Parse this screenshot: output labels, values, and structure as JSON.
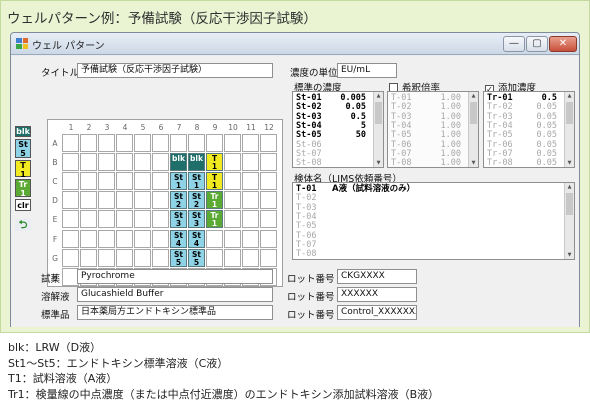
{
  "heading": "ウェルパターン例：予備試験（反応干渉因子試験）",
  "window": {
    "title": "ウェル パターン",
    "min": "—",
    "max": "▢",
    "close": "✕"
  },
  "form": {
    "title_label": "タイトル",
    "title_value": "予備試験（反応干渉因子試験）",
    "unit_label": "濃度の単位",
    "unit_value": "EU/mL",
    "reagent_label": "試薬",
    "reagent_value": "Pyrochrome",
    "solvent_label": "溶解液",
    "solvent_value": "Glucashield Buffer",
    "standard_label": "標準品",
    "standard_value": "日本薬局方エンドトキシン標準品",
    "lot_label": "ロット番号",
    "lot1": "CKGXXXX",
    "lot2": "XXXXXX",
    "lot3": "Control_XXXXXXX"
  },
  "palette": [
    {
      "label": "blk",
      "bg": "#1e6f6a",
      "fg": "#ffffff"
    },
    {
      "label": "St\n5",
      "bg": "#8fd3e6",
      "fg": "#000000"
    },
    {
      "label": "T\n1",
      "bg": "#f2ea20",
      "fg": "#000000"
    },
    {
      "label": "Tr\n1",
      "bg": "#5aaa34",
      "fg": "#ffffff"
    },
    {
      "label": "clr",
      "bg": "#ffffff",
      "fg": "#000000"
    },
    {
      "label": "⮌",
      "bg": "#e9edf2",
      "fg": "#2a8a2a"
    }
  ],
  "plate": {
    "columns": [
      "1",
      "2",
      "3",
      "4",
      "5",
      "6",
      "7",
      "8",
      "9",
      "10",
      "11",
      "12"
    ],
    "rows": [
      "A",
      "B",
      "C",
      "D",
      "E",
      "F",
      "G",
      "H"
    ],
    "wells": [
      {
        "row": 1,
        "col": 6,
        "text": "blk",
        "type": "blk"
      },
      {
        "row": 1,
        "col": 7,
        "text": "blk",
        "type": "blk"
      },
      {
        "row": 1,
        "col": 8,
        "text": "T\n1",
        "type": "t"
      },
      {
        "row": 2,
        "col": 6,
        "text": "St\n1",
        "type": "st"
      },
      {
        "row": 2,
        "col": 7,
        "text": "St\n1",
        "type": "st"
      },
      {
        "row": 2,
        "col": 8,
        "text": "T\n1",
        "type": "t"
      },
      {
        "row": 3,
        "col": 6,
        "text": "St\n2",
        "type": "st"
      },
      {
        "row": 3,
        "col": 7,
        "text": "St\n2",
        "type": "st"
      },
      {
        "row": 3,
        "col": 8,
        "text": "Tr\n1",
        "type": "tr"
      },
      {
        "row": 4,
        "col": 6,
        "text": "St\n3",
        "type": "st"
      },
      {
        "row": 4,
        "col": 7,
        "text": "St\n3",
        "type": "st"
      },
      {
        "row": 4,
        "col": 8,
        "text": "Tr\n1",
        "type": "tr"
      },
      {
        "row": 5,
        "col": 6,
        "text": "St\n4",
        "type": "st"
      },
      {
        "row": 5,
        "col": 7,
        "text": "St\n4",
        "type": "st"
      },
      {
        "row": 6,
        "col": 6,
        "text": "St\n5",
        "type": "st"
      },
      {
        "row": 6,
        "col": 7,
        "text": "St\n5",
        "type": "st"
      }
    ],
    "colors": {
      "blk": {
        "bg": "#1e6f6a",
        "fg": "#ffffff"
      },
      "st": {
        "bg": "#8fd3e6",
        "fg": "#000000"
      },
      "t": {
        "bg": "#f2ea20",
        "fg": "#000000"
      },
      "tr": {
        "bg": "#5aaa34",
        "fg": "#ffffff"
      }
    }
  },
  "std": {
    "header": "標準の濃度",
    "rows": [
      {
        "k": "St-01",
        "v": "0.005",
        "active": true
      },
      {
        "k": "St-02",
        "v": "0.05",
        "active": true
      },
      {
        "k": "St-03",
        "v": "0.5",
        "active": true
      },
      {
        "k": "St-04",
        "v": "5",
        "active": true
      },
      {
        "k": "St-05",
        "v": "50",
        "active": true
      },
      {
        "k": "St-06",
        "v": "",
        "active": false
      },
      {
        "k": "St-07",
        "v": "",
        "active": false
      },
      {
        "k": "St-08",
        "v": "",
        "active": false
      }
    ]
  },
  "dil": {
    "header": "希釈倍率",
    "checked": false,
    "rows": [
      {
        "k": "T-01",
        "v": "1.00",
        "active": false
      },
      {
        "k": "T-02",
        "v": "1.00",
        "active": false
      },
      {
        "k": "T-03",
        "v": "1.00",
        "active": false
      },
      {
        "k": "T-04",
        "v": "1.00",
        "active": false
      },
      {
        "k": "T-05",
        "v": "1.00",
        "active": false
      },
      {
        "k": "T-06",
        "v": "1.00",
        "active": false
      },
      {
        "k": "T-07",
        "v": "1.00",
        "active": false
      },
      {
        "k": "T-08",
        "v": "1.00",
        "active": false
      }
    ]
  },
  "spike": {
    "header": "添加濃度",
    "checked": true,
    "rows": [
      {
        "k": "Tr-01",
        "v": "0.5",
        "active": true
      },
      {
        "k": "Tr-02",
        "v": "0.05",
        "active": false
      },
      {
        "k": "Tr-03",
        "v": "0.05",
        "active": false
      },
      {
        "k": "Tr-04",
        "v": "0.05",
        "active": false
      },
      {
        "k": "Tr-05",
        "v": "0.05",
        "active": false
      },
      {
        "k": "Tr-06",
        "v": "0.05",
        "active": false
      },
      {
        "k": "Tr-07",
        "v": "0.05",
        "active": false
      },
      {
        "k": "Tr-08",
        "v": "0.05",
        "active": false
      }
    ]
  },
  "samples": {
    "header": "検体名（LIMS依頼番号）",
    "rows": [
      {
        "k": "T-01",
        "v": "A液（試料溶液のみ）",
        "active": true
      },
      {
        "k": "T-02",
        "v": "",
        "active": false
      },
      {
        "k": "T-03",
        "v": "",
        "active": false
      },
      {
        "k": "T-04",
        "v": "",
        "active": false
      },
      {
        "k": "T-05",
        "v": "",
        "active": false
      },
      {
        "k": "T-06",
        "v": "",
        "active": false
      },
      {
        "k": "T-07",
        "v": "",
        "active": false
      },
      {
        "k": "T-08",
        "v": "",
        "active": false
      }
    ]
  },
  "legend": [
    "blk：LRW（D液）",
    "St1〜St5：エンドトキシン標準溶液（C液）",
    "T1：試料溶液（A液）",
    "Tr1：検量線の中点濃度（または中点付近濃度）のエンドトキシン添加試料溶液（B液）"
  ]
}
